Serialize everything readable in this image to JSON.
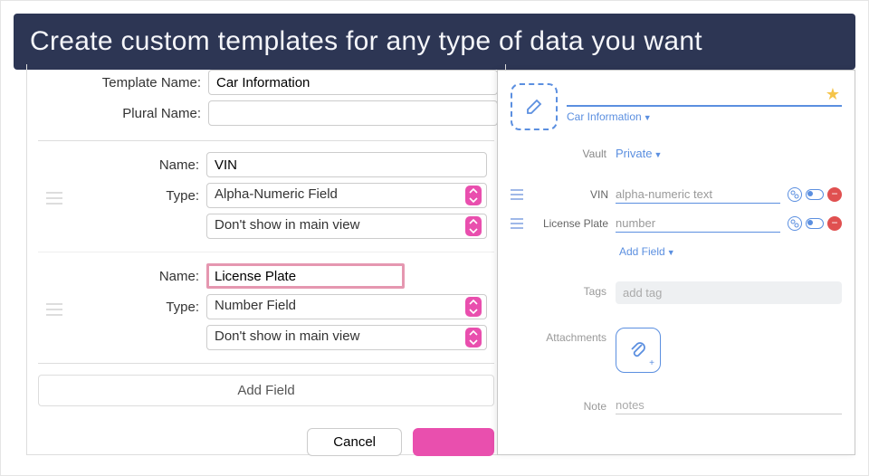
{
  "banner": {
    "text": "Create custom templates for any type of data you want"
  },
  "left": {
    "template_name_label": "Template Name:",
    "template_name_value": "Car Information",
    "plural_name_label": "Plural Name:",
    "plural_name_value": "",
    "fields": [
      {
        "name_label": "Name:",
        "name_value": "VIN",
        "type_label": "Type:",
        "type_value": "Alpha-Numeric Field",
        "visibility": "Don't show in main view",
        "focused": false
      },
      {
        "name_label": "Name:",
        "name_value": "License Plate",
        "type_label": "Type:",
        "type_value": "Number Field",
        "visibility": "Don't show in main view",
        "focused": true
      }
    ],
    "add_field_label": "Add Field",
    "cancel_label": "Cancel",
    "save_label": ""
  },
  "right": {
    "category": "Car Information",
    "vault_label": "Vault",
    "vault_value": "Private",
    "fields": [
      {
        "label": "VIN",
        "placeholder": "alpha-numeric text"
      },
      {
        "label": "License Plate",
        "placeholder": "number"
      }
    ],
    "add_field": "Add Field",
    "tags_label": "Tags",
    "tags_placeholder": "add tag",
    "attachments_label": "Attachments",
    "note_label": "Note",
    "note_placeholder": "notes"
  },
  "icons": {
    "pencil": "pencil-icon",
    "star": "star-icon",
    "link": "link-icon",
    "toggle": "toggle-icon",
    "minus": "minus-icon",
    "paperclip": "paperclip-icon"
  }
}
